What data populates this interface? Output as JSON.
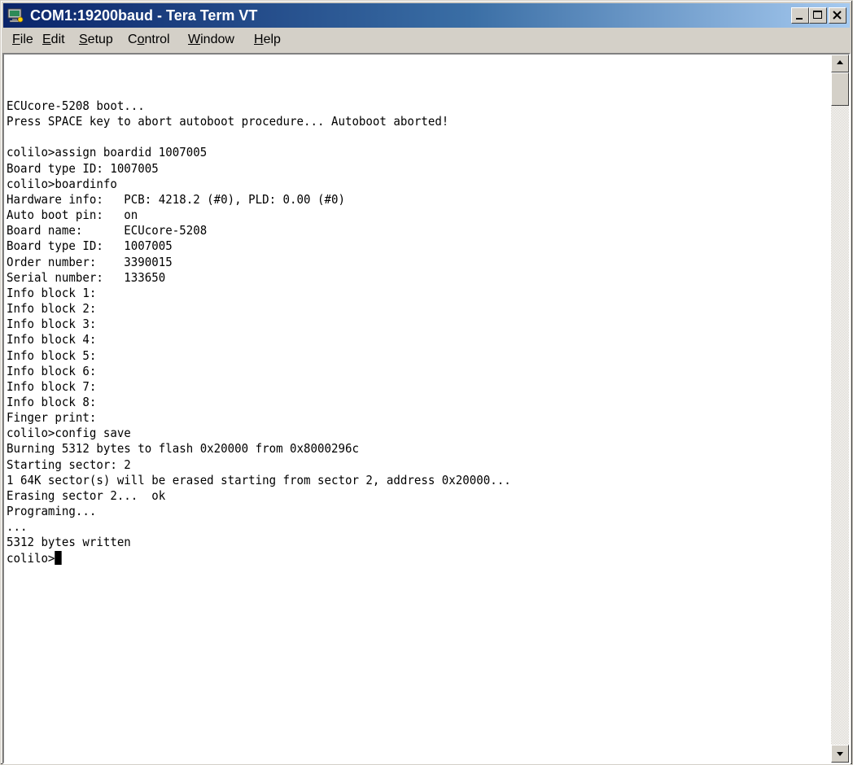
{
  "window": {
    "title": "COM1:19200baud - Tera Term VT",
    "app_icon": "tera-term-icon",
    "controls": {
      "minimize": "minimize-icon",
      "maximize": "maximize-icon",
      "close": "close-icon"
    }
  },
  "menu": {
    "items": [
      {
        "pre": "",
        "key": "F",
        "post": "ile"
      },
      {
        "pre": "",
        "key": "E",
        "post": "dit"
      },
      {
        "pre": "",
        "key": "S",
        "post": "etup"
      },
      {
        "pre": "C",
        "key": "o",
        "post": "ntrol"
      },
      {
        "pre": "",
        "key": "W",
        "post": "indow"
      },
      {
        "pre": "",
        "key": "H",
        "post": "elp"
      }
    ]
  },
  "terminal": {
    "lines": [
      "ECUcore-5208 boot...",
      "Press SPACE key to abort autoboot procedure... Autoboot aborted!",
      "",
      "colilo>assign boardid 1007005",
      "Board type ID: 1007005",
      "colilo>boardinfo",
      "Hardware info:   PCB: 4218.2 (#0), PLD: 0.00 (#0)",
      "Auto boot pin:   on",
      "Board name:      ECUcore-5208",
      "Board type ID:   1007005",
      "Order number:    3390015",
      "Serial number:   133650",
      "Info block 1:",
      "Info block 2:",
      "Info block 3:",
      "Info block 4:",
      "Info block 5:",
      "Info block 6:",
      "Info block 7:",
      "Info block 8:",
      "Finger print:",
      "colilo>config save",
      "Burning 5312 bytes to flash 0x20000 from 0x8000296c",
      "Starting sector: 2",
      "1 64K sector(s) will be erased starting from sector 2, address 0x20000...",
      "Erasing sector 2...  ok",
      "Programing...",
      "...",
      "5312 bytes written"
    ],
    "prompt": "colilo>"
  },
  "colors": {
    "titlebar_start": "#0a246a",
    "titlebar_end": "#a6caf0",
    "terminal_bg": "#ffffff",
    "terminal_fg": "#000000",
    "chrome": "#d4d0c8"
  },
  "scrollbar": {
    "up_icon": "scroll-up-arrow-icon",
    "down_icon": "scroll-down-arrow-icon"
  }
}
